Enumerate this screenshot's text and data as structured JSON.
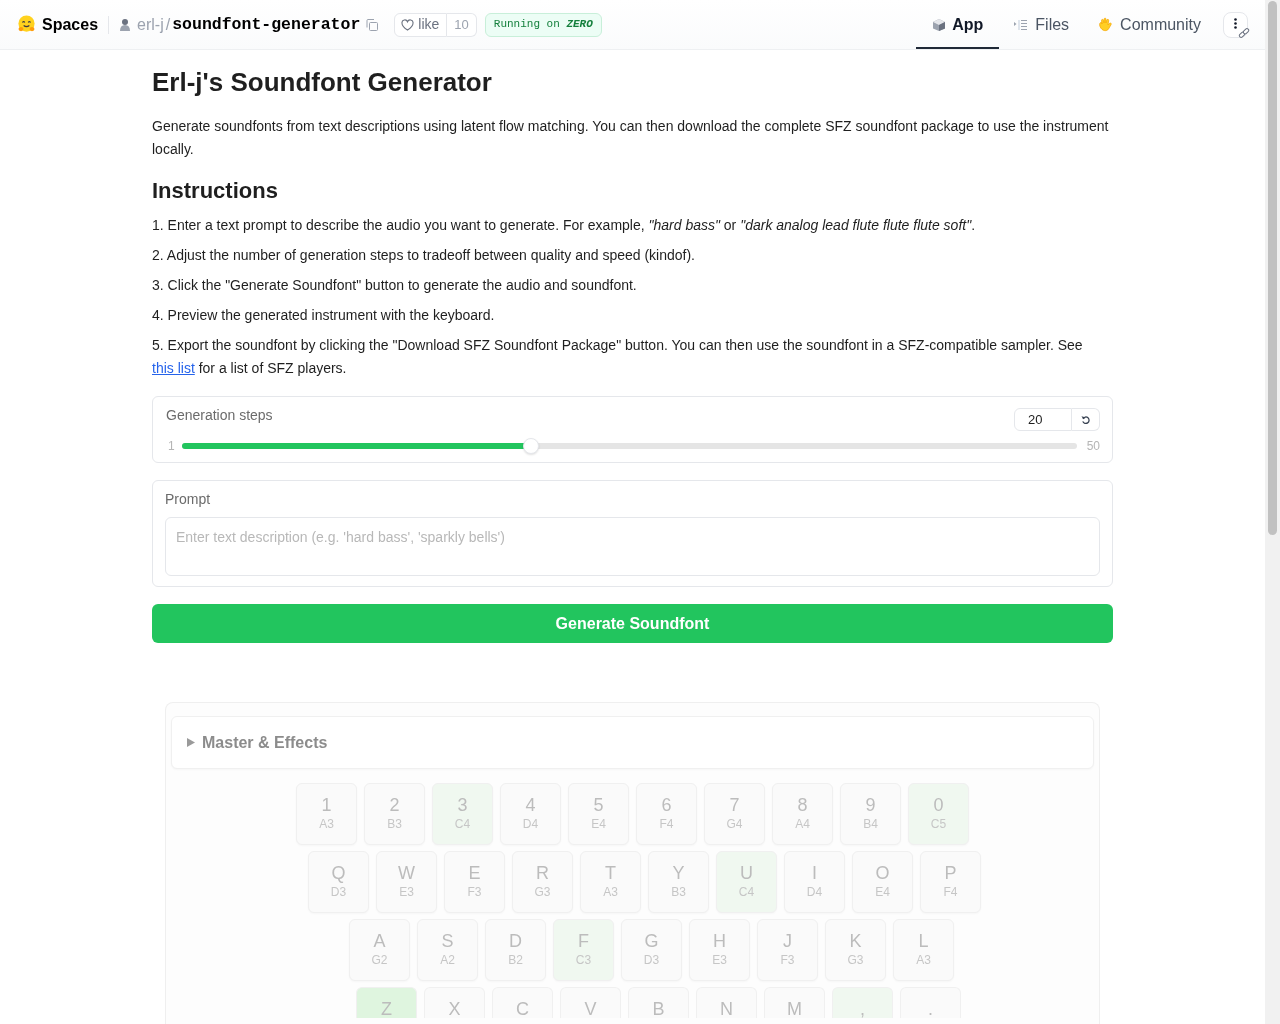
{
  "header": {
    "brand": "Spaces",
    "owner": "erl-j",
    "separator": "/",
    "repo": "soundfont-generator",
    "like": {
      "label": "like",
      "count": "10"
    },
    "status": {
      "prefix": "Running on",
      "emphasis": "ZERO"
    },
    "tabs": [
      {
        "label": "App",
        "kind": "app",
        "selected": true
      },
      {
        "label": "Files",
        "kind": "files",
        "selected": false
      },
      {
        "label": "Community",
        "kind": "community",
        "selected": false
      }
    ]
  },
  "title": "Erl-j's Soundfont Generator",
  "intro": "Generate soundfonts from text descriptions using latent flow matching. You can then download the complete SFZ soundfont package to use the instrument locally.",
  "instructions": {
    "heading": "Instructions",
    "steps": [
      {
        "text": "1. Enter a text prompt to describe the audio you want to generate. For example, *\"hard bass\"* or *\"dark analog lead flute flute flute soft\"*."
      },
      {
        "text": "2. Adjust the number of generation steps to tradeoff between quality and speed (kindof)."
      },
      {
        "text": "3. Click the \"Generate Soundfont\" button to generate the audio and soundfont."
      },
      {
        "text": "4. Preview the generated instrument with the keyboard."
      },
      {
        "text": "5. Export the soundfont by clicking the \"Download SFZ Soundfont Package\" button. You can then use the soundfont in a SFZ-compatible sampler. See",
        "link": "this list",
        "after": "for a list of SFZ players."
      }
    ]
  },
  "steps": {
    "label": "Generation steps",
    "value": "20",
    "min": "1",
    "max": "50",
    "level": 0.388
  },
  "prompt": {
    "label": "Prompt",
    "placeholder": "Enter text description (e.g. 'hard bass', 'sparkly bells')"
  },
  "generate_button": "Generate Soundfont",
  "effects": {
    "label": "Master & Effects",
    "expanded": false
  },
  "keyboard": {
    "rows": [
      [
        {
          "key": "1",
          "note": "A3",
          "color": "#fafafa"
        },
        {
          "key": "2",
          "note": "B3",
          "color": "#fafafa"
        },
        {
          "key": "3",
          "note": "C4",
          "color": "#f0f8f0"
        },
        {
          "key": "4",
          "note": "D4",
          "color": "#fafafa"
        },
        {
          "key": "5",
          "note": "E4",
          "color": "#fafafa"
        },
        {
          "key": "6",
          "note": "F4",
          "color": "#fafafa"
        },
        {
          "key": "7",
          "note": "G4",
          "color": "#fafafa"
        },
        {
          "key": "8",
          "note": "A4",
          "color": "#fafafa"
        },
        {
          "key": "9",
          "note": "B4",
          "color": "#fafafa"
        },
        {
          "key": "0",
          "note": "C5",
          "color": "#f0f8f0"
        }
      ],
      [
        {
          "key": "Q",
          "note": "D3",
          "color": "#fafafa"
        },
        {
          "key": "W",
          "note": "E3",
          "color": "#fafafa"
        },
        {
          "key": "E",
          "note": "F3",
          "color": "#fafafa"
        },
        {
          "key": "R",
          "note": "G3",
          "color": "#fafafa"
        },
        {
          "key": "T",
          "note": "A3",
          "color": "#fafafa"
        },
        {
          "key": "Y",
          "note": "B3",
          "color": "#fafafa"
        },
        {
          "key": "U",
          "note": "C4",
          "color": "#f0f8f0"
        },
        {
          "key": "I",
          "note": "D4",
          "color": "#fafafa"
        },
        {
          "key": "O",
          "note": "E4",
          "color": "#fafafa"
        },
        {
          "key": "P",
          "note": "F4",
          "color": "#fafafa"
        }
      ],
      [
        {
          "key": "A",
          "note": "G2",
          "color": "#fafafa"
        },
        {
          "key": "S",
          "note": "A2",
          "color": "#fafafa"
        },
        {
          "key": "D",
          "note": "B2",
          "color": "#fafafa"
        },
        {
          "key": "F",
          "note": "C3",
          "color": "#f0f8f0"
        },
        {
          "key": "G",
          "note": "D3",
          "color": "#fafafa"
        },
        {
          "key": "H",
          "note": "E3",
          "color": "#fafafa"
        },
        {
          "key": "J",
          "note": "F3",
          "color": "#fafafa"
        },
        {
          "key": "K",
          "note": "G3",
          "color": "#fafafa"
        },
        {
          "key": "L",
          "note": "A3",
          "color": "#fafafa"
        }
      ],
      [
        {
          "key": "Z",
          "color": "#dff5df"
        },
        {
          "key": "X",
          "color": "#fafafa"
        },
        {
          "key": "C",
          "color": "#fafafa"
        },
        {
          "key": "V",
          "color": "#fafafa"
        },
        {
          "key": "B",
          "color": "#fafafa"
        },
        {
          "key": "N",
          "color": "#fafafa"
        },
        {
          "key": "M",
          "color": "#fafafa"
        },
        {
          "key": ",",
          "color": "#f0f8f0"
        },
        {
          "key": ".",
          "color": "#fafafa"
        }
      ]
    ]
  }
}
